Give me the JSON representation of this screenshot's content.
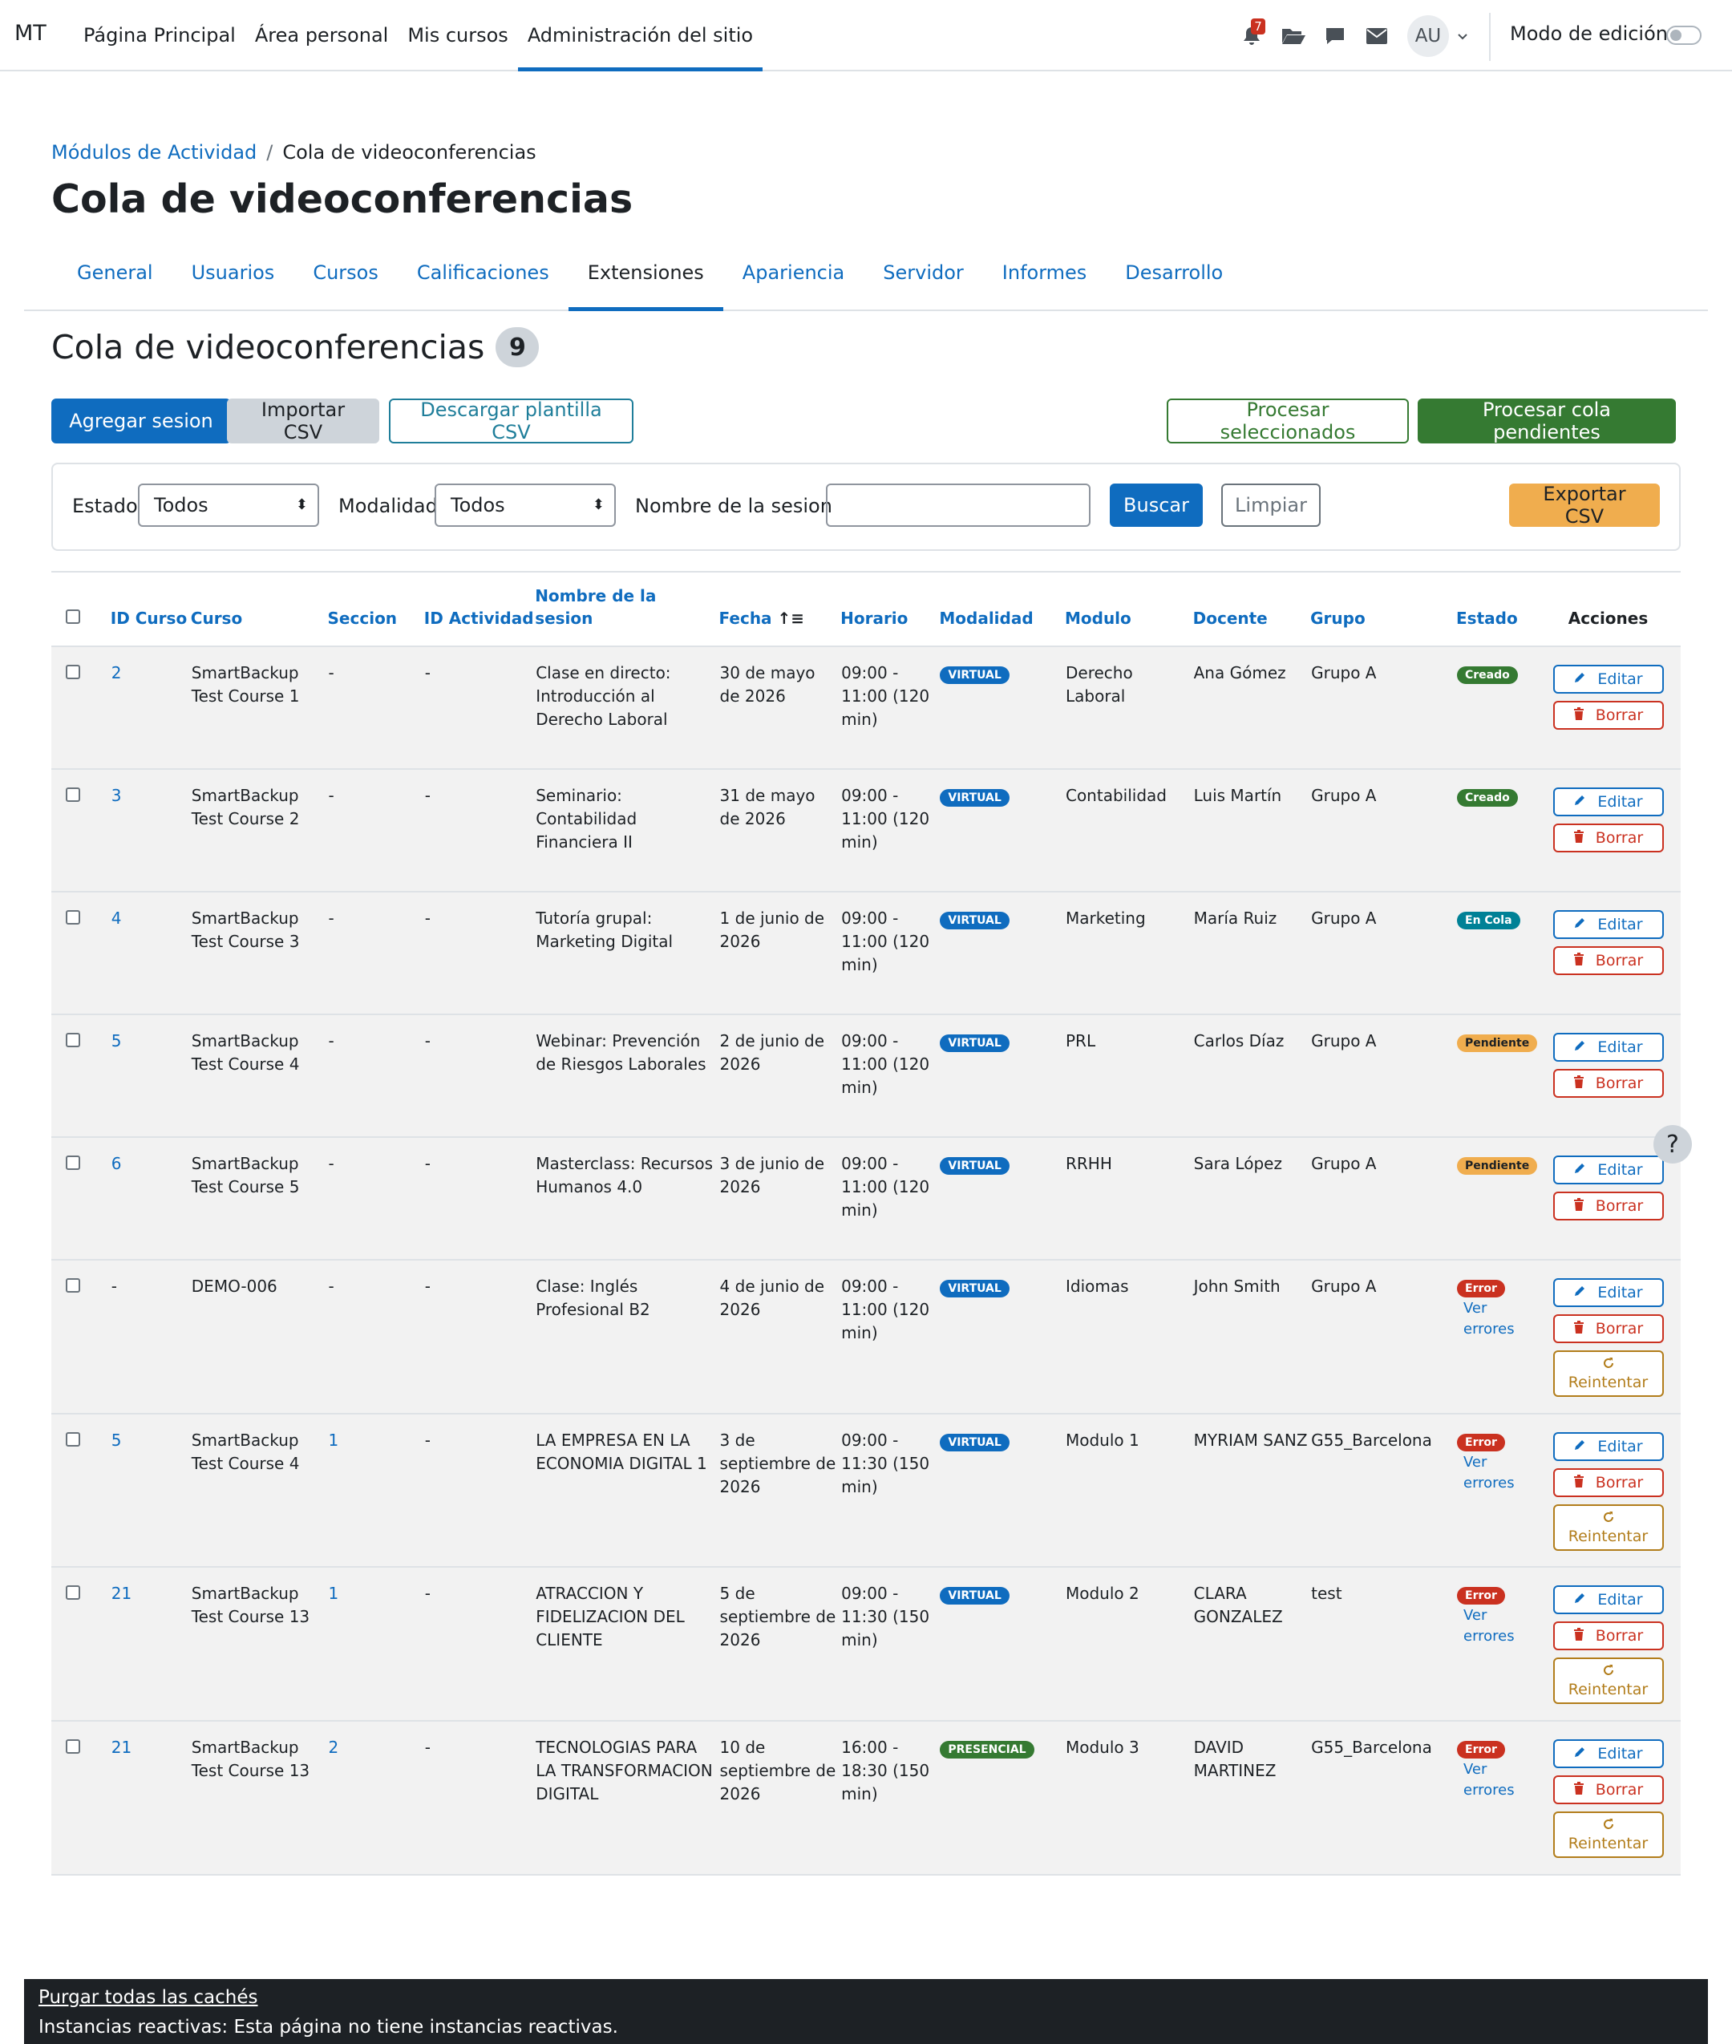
{
  "navbar": {
    "brand": "MT",
    "links": [
      "Página Principal",
      "Área personal",
      "Mis cursos",
      "Administración del sitio"
    ],
    "active_link": "Administración del sitio",
    "notification_count": "7",
    "user_initials": "AU",
    "edit_mode_label": "Modo de edición"
  },
  "breadcrumb": {
    "parent": "Módulos de Actividad",
    "current": "Cola de videoconferencias"
  },
  "page_title": "Cola de videoconferencias",
  "tabs": [
    "General",
    "Usuarios",
    "Cursos",
    "Calificaciones",
    "Extensiones",
    "Apariencia",
    "Servidor",
    "Informes",
    "Desarrollo"
  ],
  "active_tab": "Extensiones",
  "section": {
    "title": "Cola de videoconferencias",
    "count": "9"
  },
  "toolbar": {
    "add": "Agregar sesion",
    "import": "Importar CSV",
    "download_template": "Descargar plantilla CSV",
    "process_selected": "Procesar seleccionados",
    "process_pending": "Procesar cola pendientes"
  },
  "filters": {
    "estado_label": "Estado",
    "estado_value": "Todos",
    "modalidad_label": "Modalidad",
    "modalidad_value": "Todos",
    "nombre_label": "Nombre de la sesion",
    "nombre_value": "",
    "search": "Buscar",
    "clear": "Limpiar",
    "export": "Exportar CSV"
  },
  "table": {
    "headers": {
      "id_curso": "ID Curso",
      "curso": "Curso",
      "seccion": "Seccion",
      "id_actividad": "ID Actividad",
      "nombre": "Nombre de la sesion",
      "fecha": "Fecha",
      "horario": "Horario",
      "modalidad": "Modalidad",
      "modulo": "Modulo",
      "docente": "Docente",
      "grupo": "Grupo",
      "estado": "Estado",
      "acciones": "Acciones"
    },
    "edit_label": "Editar",
    "delete_label": "Borrar",
    "retry_label": "Reintentar",
    "errors_link": "Ver errores",
    "rows": [
      {
        "id_curso": "2",
        "curso": "SmartBackup Test Course 1",
        "seccion": "-",
        "id_actividad": "-",
        "nombre": "Clase en directo: Introducción al Derecho Laboral",
        "fecha": "30 de mayo de 2026",
        "horario": "09:00 - 11:00 (120 min)",
        "modalidad": "VIRTUAL",
        "modulo": "Derecho Laboral",
        "docente": "Ana Gómez",
        "grupo": "Grupo A",
        "estado": "Creado"
      },
      {
        "id_curso": "3",
        "curso": "SmartBackup Test Course 2",
        "seccion": "-",
        "id_actividad": "-",
        "nombre": "Seminario: Contabilidad Financiera II",
        "fecha": "31 de mayo de 2026",
        "horario": "09:00 - 11:00 (120 min)",
        "modalidad": "VIRTUAL",
        "modulo": "Contabilidad",
        "docente": "Luis Martín",
        "grupo": "Grupo A",
        "estado": "Creado"
      },
      {
        "id_curso": "4",
        "curso": "SmartBackup Test Course 3",
        "seccion": "-",
        "id_actividad": "-",
        "nombre": "Tutoría grupal: Marketing Digital",
        "fecha": "1 de junio de 2026",
        "horario": "09:00 - 11:00 (120 min)",
        "modalidad": "VIRTUAL",
        "modulo": "Marketing",
        "docente": "María Ruiz",
        "grupo": "Grupo A",
        "estado": "En Cola"
      },
      {
        "id_curso": "5",
        "curso": "SmartBackup Test Course 4",
        "seccion": "-",
        "id_actividad": "-",
        "nombre": "Webinar: Prevención de Riesgos Laborales",
        "fecha": "2 de junio de 2026",
        "horario": "09:00 - 11:00 (120 min)",
        "modalidad": "VIRTUAL",
        "modulo": "PRL",
        "docente": "Carlos Díaz",
        "grupo": "Grupo A",
        "estado": "Pendiente"
      },
      {
        "id_curso": "6",
        "curso": "SmartBackup Test Course 5",
        "seccion": "-",
        "id_actividad": "-",
        "nombre": "Masterclass: Recursos Humanos 4.0",
        "fecha": "3 de junio de 2026",
        "horario": "09:00 - 11:00 (120 min)",
        "modalidad": "VIRTUAL",
        "modulo": "RRHH",
        "docente": "Sara López",
        "grupo": "Grupo A",
        "estado": "Pendiente"
      },
      {
        "id_curso": "-",
        "curso": "DEMO-006",
        "seccion": "-",
        "id_actividad": "-",
        "nombre": "Clase: Inglés Profesional B2",
        "fecha": "4 de junio de 2026",
        "horario": "09:00 - 11:00 (120 min)",
        "modalidad": "VIRTUAL",
        "modulo": "Idiomas",
        "docente": "John Smith",
        "grupo": "Grupo A",
        "estado": "Error"
      },
      {
        "id_curso": "5",
        "curso": "SmartBackup Test Course 4",
        "seccion": "1",
        "id_actividad": "-",
        "nombre": "LA EMPRESA EN LA ECONOMIA DIGITAL 1",
        "fecha": "3 de septiembre de 2026",
        "horario": "09:00 - 11:30 (150 min)",
        "modalidad": "VIRTUAL",
        "modulo": "Modulo 1",
        "docente": "MYRIAM SANZ",
        "grupo": "G55_Barcelona",
        "estado": "Error"
      },
      {
        "id_curso": "21",
        "curso": "SmartBackup Test Course 13",
        "seccion": "1",
        "id_actividad": "-",
        "nombre": "ATRACCION Y FIDELIZACION DEL CLIENTE",
        "fecha": "5 de septiembre de 2026",
        "horario": "09:00 - 11:30 (150 min)",
        "modalidad": "VIRTUAL",
        "modulo": "Modulo 2",
        "docente": "CLARA GONZALEZ",
        "grupo": "test",
        "estado": "Error"
      },
      {
        "id_curso": "21",
        "curso": "SmartBackup Test Course 13",
        "seccion": "2",
        "id_actividad": "-",
        "nombre": "TECNOLOGIAS PARA LA TRANSFORMACION DIGITAL",
        "fecha": "10 de septiembre de 2026",
        "horario": "16:00 - 18:30 (150 min)",
        "modalidad": "PRESENCIAL",
        "modulo": "Modulo 3",
        "docente": "DAVID MARTINEZ",
        "grupo": "G55_Barcelona",
        "estado": "Error"
      }
    ]
  },
  "help": "?",
  "footer": {
    "purge": "Purgar todas las cachés",
    "reactive": "Instancias reactivas: Esta página no tiene instancias reactivas."
  },
  "colors": {
    "primary": "#0f6cbf",
    "success": "#357a32",
    "danger": "#ca3120",
    "warning": "#f0ad4e",
    "info": "#008196"
  }
}
